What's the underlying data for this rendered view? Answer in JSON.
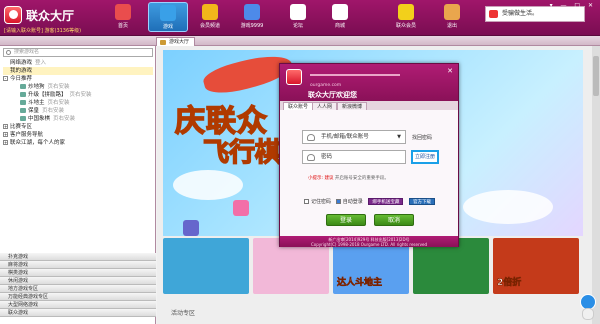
{
  "app": {
    "title": "联众大厅",
    "subtitle": "[请输入联众账号] 游客(3136等级)",
    "notice": "受骗做生活。",
    "window_controls": "▾ — □ ✕"
  },
  "nav": [
    {
      "label": "首页",
      "icon": "home-icon",
      "color": "#e94d4d"
    },
    {
      "label": "游戏",
      "icon": "game-icon",
      "color": "#39a0e8"
    },
    {
      "label": "会员频道",
      "icon": "crown-icon",
      "color": "#f2b51b"
    },
    {
      "label": "游戏9999",
      "icon": "bar-icon",
      "color": "#4d8ae9"
    },
    {
      "label": "论坛",
      "icon": "chat-icon",
      "color": "#ffffff"
    },
    {
      "label": "商城",
      "icon": "store-icon",
      "color": "#ffffff"
    },
    {
      "label": "联众会员",
      "icon": "shirt-icon",
      "color": "#f2d01b"
    },
    {
      "label": "退出",
      "icon": "door-icon",
      "color": "#e9a64d"
    }
  ],
  "tab": {
    "label": "游戏大厅"
  },
  "sidebar": {
    "search_placeholder": "搜索游戏名",
    "tree": [
      {
        "label": "网络游戏",
        "tag": "登入",
        "highlight": false,
        "expander": "",
        "indent": 0,
        "icon": false
      },
      {
        "label": "我的游戏",
        "tag": "",
        "highlight": true,
        "expander": "",
        "indent": 0,
        "icon": false
      },
      {
        "label": "今日推荐",
        "tag": "",
        "highlight": false,
        "expander": "-",
        "indent": 0,
        "icon": false
      },
      {
        "label": "炒地狗",
        "tag": "页右安装",
        "highlight": false,
        "expander": "",
        "indent": 1,
        "icon": true
      },
      {
        "label": "升级【拼励路】",
        "tag": "页右安装",
        "highlight": false,
        "expander": "",
        "indent": 1,
        "icon": true
      },
      {
        "label": "斗地主",
        "tag": "页右安装",
        "highlight": false,
        "expander": "",
        "indent": 1,
        "icon": true
      },
      {
        "label": "保皇",
        "tag": "页右安装",
        "highlight": false,
        "expander": "",
        "indent": 1,
        "icon": true
      },
      {
        "label": "中国象棋",
        "tag": "页右安装",
        "highlight": false,
        "expander": "",
        "indent": 1,
        "icon": true
      },
      {
        "label": "比赛专区",
        "tag": "",
        "highlight": false,
        "expander": "+",
        "indent": 0,
        "icon": false
      },
      {
        "label": "客户服务导航",
        "tag": "",
        "highlight": false,
        "expander": "+",
        "indent": 0,
        "icon": false
      },
      {
        "label": "联众江湖，每个人的家",
        "tag": "",
        "highlight": false,
        "expander": "+",
        "indent": 0,
        "icon": false
      }
    ],
    "categories": [
      "扑克游戏",
      "麻将游戏",
      "棋类游戏",
      "休闲游戏",
      "地方游戏专区",
      "万能经典游戏专区",
      "大型网络游戏",
      "联众游戏"
    ]
  },
  "main": {
    "banner_line1": "庆联众",
    "banner_line2": "飞行棋",
    "thumbs": [
      {
        "text": "",
        "color": "#3fa6d8"
      },
      {
        "text": "",
        "color": "#f2b8d8"
      },
      {
        "text": "达人斗地主",
        "color": "#5aa0f0"
      },
      {
        "text": "",
        "color": "#2b8a3c"
      },
      {
        "text": "2倍折",
        "color": "#c43a1a"
      }
    ],
    "area_label": "活动专区"
  },
  "login": {
    "url": "ourgame.com",
    "title": "联众大厅欢迎您",
    "tabs": [
      "联众账号",
      "人人网",
      "新浪微博"
    ],
    "account_placeholder": "手机/邮箱/联众账号",
    "password_placeholder": "密码",
    "find_password": "找回密码",
    "register": "立即注册",
    "tip_prefix": "小提示:",
    "tip_red": "建议",
    "tip_text": "开启账号安全的重要手段。",
    "remember": "记住密码",
    "auto_login": "自动登录",
    "bind_phone": "绑手机送宝藏",
    "official_download": "官方下载",
    "login_btn": "登录",
    "cancel_btn": "取消",
    "footer1": "新广出审[2014]929号 科技出版[2013]2D号",
    "footer2": "Copyright(C) 1998-2018 Ourgame LTD. All rights reserved"
  }
}
